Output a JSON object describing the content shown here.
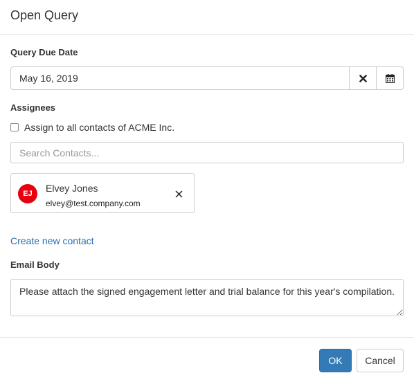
{
  "dialog": {
    "title": "Open Query"
  },
  "due_date": {
    "label": "Query Due Date",
    "value": "May 16, 2019",
    "clear_icon": "close-icon",
    "calendar_icon": "calendar-icon"
  },
  "assignees": {
    "label": "Assignees",
    "assign_all_label": "Assign to all contacts of ACME Inc.",
    "assign_all_checked": false,
    "search_placeholder": "Search Contacts...",
    "contacts": [
      {
        "initials": "EJ",
        "name": "Elvey Jones",
        "email": "elvey@test.company.com",
        "avatar_color": "#e8000f"
      }
    ],
    "create_link": "Create new contact"
  },
  "email_body": {
    "label": "Email Body",
    "value": "Please attach the signed engagement letter and trial balance for this year's compilation."
  },
  "footer": {
    "ok_label": "OK",
    "cancel_label": "Cancel"
  },
  "colors": {
    "primary": "#337ab7",
    "link": "#2a6fb0",
    "avatar": "#e8000f"
  }
}
